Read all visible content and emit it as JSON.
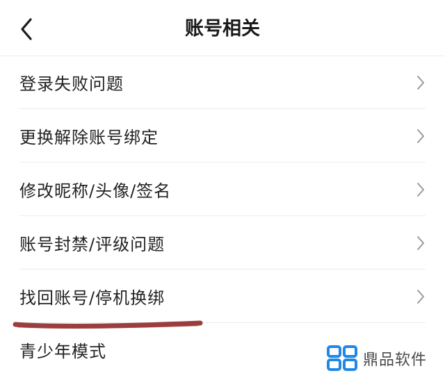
{
  "header": {
    "title": "账号相关",
    "back_icon": "chevron-left-icon"
  },
  "menu": {
    "items": [
      {
        "label": "登录失败问题"
      },
      {
        "label": "更换解除账号绑定"
      },
      {
        "label": "修改昵称/头像/签名"
      },
      {
        "label": "账号封禁/评级问题"
      },
      {
        "label": "找回账号/停机换绑"
      },
      {
        "label": "青少年模式"
      }
    ],
    "chevron_icon": "chevron-right-icon"
  },
  "annotation": {
    "underline_color": "#8e2a2a",
    "underlined_item": "找回账号/停机换绑"
  },
  "watermark": {
    "text": "鼎品软件",
    "logo_color": "#1e88e5"
  }
}
